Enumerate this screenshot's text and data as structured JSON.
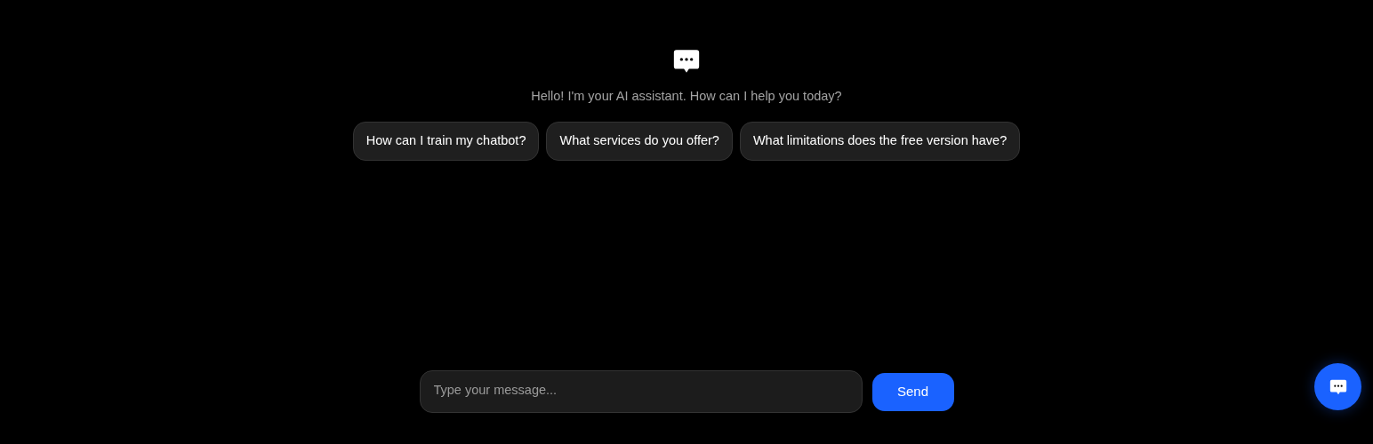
{
  "greeting": "Hello! I'm your AI assistant. How can I help you today?",
  "suggestions": [
    "How can I train my chatbot?",
    "What services do you offer?",
    "What limitations does the free version have?"
  ],
  "composer": {
    "placeholder": "Type your message...",
    "send_label": "Send"
  }
}
